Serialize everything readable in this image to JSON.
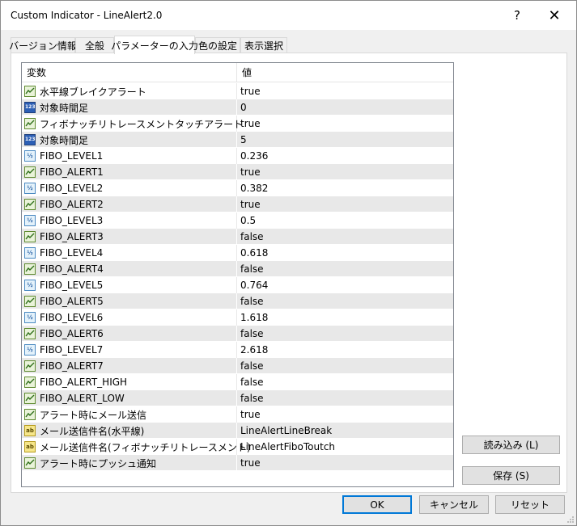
{
  "window": {
    "title": "Custom Indicator - LineAlert2.0",
    "help_label": "?",
    "close_label": "✕"
  },
  "tabs": [
    {
      "label": "バージョン情報",
      "active": false
    },
    {
      "label": "全般",
      "active": false
    },
    {
      "label": "パラメーターの入力",
      "active": true
    },
    {
      "label": "色の設定",
      "active": false
    },
    {
      "label": "表示選択",
      "active": false
    }
  ],
  "grid": {
    "headers": {
      "variable": "変数",
      "value": "値"
    },
    "rows": [
      {
        "type": "bool",
        "icon": "bool-icon",
        "name": "水平線ブレイクアラート",
        "value": "true"
      },
      {
        "type": "int",
        "icon": "int-icon",
        "icon_text": "123",
        "name": "対象時間足",
        "value": "0"
      },
      {
        "type": "bool",
        "icon": "bool-icon",
        "name": "フィボナッチリトレースメントタッチアラート",
        "value": "true"
      },
      {
        "type": "int",
        "icon": "int-icon",
        "icon_text": "123",
        "name": "対象時間足",
        "value": "5"
      },
      {
        "type": "dbl",
        "icon": "double-icon",
        "icon_text": "½",
        "name": "FIBO_LEVEL1",
        "value": "0.236"
      },
      {
        "type": "bool",
        "icon": "bool-icon",
        "name": "FIBO_ALERT1",
        "value": "true"
      },
      {
        "type": "dbl",
        "icon": "double-icon",
        "icon_text": "½",
        "name": "FIBO_LEVEL2",
        "value": "0.382"
      },
      {
        "type": "bool",
        "icon": "bool-icon",
        "name": "FIBO_ALERT2",
        "value": "true"
      },
      {
        "type": "dbl",
        "icon": "double-icon",
        "icon_text": "½",
        "name": "FIBO_LEVEL3",
        "value": "0.5"
      },
      {
        "type": "bool",
        "icon": "bool-icon",
        "name": "FIBO_ALERT3",
        "value": "false"
      },
      {
        "type": "dbl",
        "icon": "double-icon",
        "icon_text": "½",
        "name": "FIBO_LEVEL4",
        "value": "0.618"
      },
      {
        "type": "bool",
        "icon": "bool-icon",
        "name": "FIBO_ALERT4",
        "value": "false"
      },
      {
        "type": "dbl",
        "icon": "double-icon",
        "icon_text": "½",
        "name": "FIBO_LEVEL5",
        "value": "0.764"
      },
      {
        "type": "bool",
        "icon": "bool-icon",
        "name": "FIBO_ALERT5",
        "value": "false"
      },
      {
        "type": "dbl",
        "icon": "double-icon",
        "icon_text": "½",
        "name": "FIBO_LEVEL6",
        "value": "1.618"
      },
      {
        "type": "bool",
        "icon": "bool-icon",
        "name": "FIBO_ALERT6",
        "value": "false"
      },
      {
        "type": "dbl",
        "icon": "double-icon",
        "icon_text": "½",
        "name": "FIBO_LEVEL7",
        "value": "2.618"
      },
      {
        "type": "bool",
        "icon": "bool-icon",
        "name": "FIBO_ALERT7",
        "value": "false"
      },
      {
        "type": "bool",
        "icon": "bool-icon",
        "name": "FIBO_ALERT_HIGH",
        "value": "false"
      },
      {
        "type": "bool",
        "icon": "bool-icon",
        "name": "FIBO_ALERT_LOW",
        "value": "false"
      },
      {
        "type": "bool",
        "icon": "bool-icon",
        "name": "アラート時にメール送信",
        "value": "true"
      },
      {
        "type": "str",
        "icon": "string-icon",
        "icon_text": "ab",
        "name": "メール送信件名(水平線)",
        "value": "LineAlertLineBreak"
      },
      {
        "type": "str",
        "icon": "string-icon",
        "icon_text": "ab",
        "name": "メール送信件名(フィボナッチリトレースメント)",
        "value": "LineAlertFiboToutch"
      },
      {
        "type": "bool",
        "icon": "bool-icon",
        "name": "アラート時にプッシュ通知",
        "value": "true"
      }
    ]
  },
  "buttons": {
    "load": "読み込み (L)",
    "save": "保存 (S)",
    "ok": "OK",
    "cancel": "キャンセル",
    "reset": "リセット"
  },
  "colors": {
    "row_alt": "#e8e8e8",
    "ok_border": "#0078d7"
  }
}
